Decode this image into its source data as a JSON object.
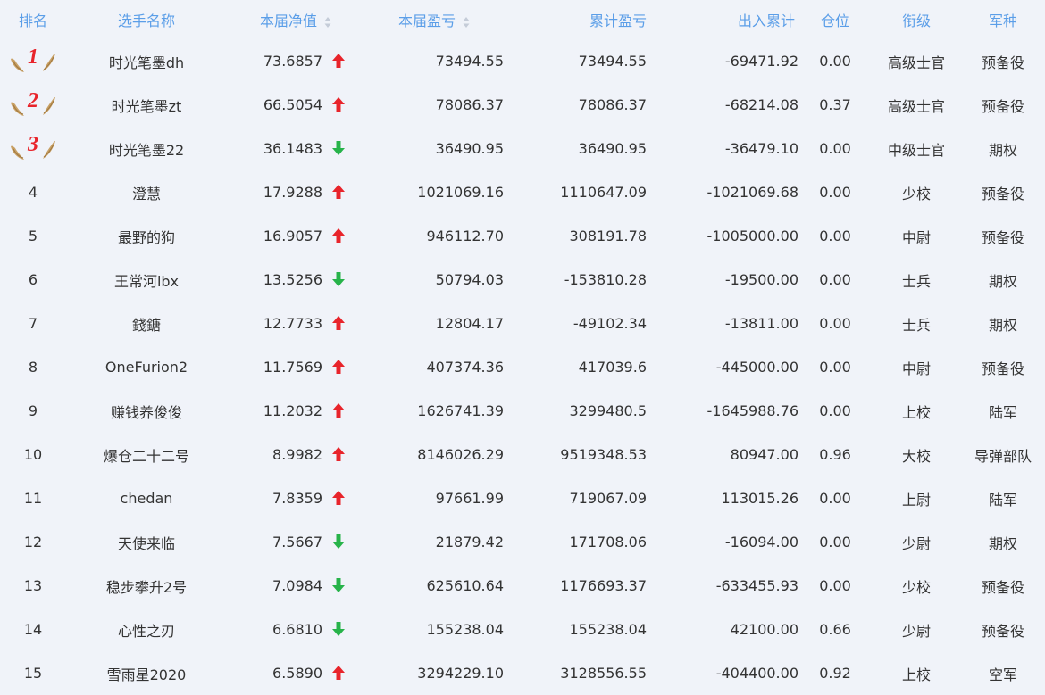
{
  "colors": {
    "header_text": "#5b9ee8",
    "up": "#e8242b",
    "down": "#27b34a",
    "wing": "#c8a064"
  },
  "columns": [
    "排名",
    "选手名称",
    "本届净值",
    "本届盈亏",
    "累计盈亏",
    "出入累计",
    "仓位",
    "衔级",
    "军种"
  ],
  "rows": [
    {
      "rank": "1",
      "name": "时光笔墨dh",
      "nav": "73.6857",
      "trend": "up",
      "pnl": "73494.55",
      "cum": "73494.55",
      "flow": "-69471.92",
      "pos": "0.00",
      "grade": "高级士官",
      "branch": "预备役"
    },
    {
      "rank": "2",
      "name": "时光笔墨zt",
      "nav": "66.5054",
      "trend": "up",
      "pnl": "78086.37",
      "cum": "78086.37",
      "flow": "-68214.08",
      "pos": "0.37",
      "grade": "高级士官",
      "branch": "预备役"
    },
    {
      "rank": "3",
      "name": "时光笔墨22",
      "nav": "36.1483",
      "trend": "down",
      "pnl": "36490.95",
      "cum": "36490.95",
      "flow": "-36479.10",
      "pos": "0.00",
      "grade": "中级士官",
      "branch": "期权"
    },
    {
      "rank": "4",
      "name": "澄慧",
      "nav": "17.9288",
      "trend": "up",
      "pnl": "1021069.16",
      "cum": "1110647.09",
      "flow": "-1021069.68",
      "pos": "0.00",
      "grade": "少校",
      "branch": "预备役"
    },
    {
      "rank": "5",
      "name": "最野的狗",
      "nav": "16.9057",
      "trend": "up",
      "pnl": "946112.70",
      "cum": "308191.78",
      "flow": "-1005000.00",
      "pos": "0.00",
      "grade": "中尉",
      "branch": "预备役"
    },
    {
      "rank": "6",
      "name": "王常河lbx",
      "nav": "13.5256",
      "trend": "down",
      "pnl": "50794.03",
      "cum": "-153810.28",
      "flow": "-19500.00",
      "pos": "0.00",
      "grade": "士兵",
      "branch": "期权"
    },
    {
      "rank": "7",
      "name": "錢鎕",
      "nav": "12.7733",
      "trend": "up",
      "pnl": "12804.17",
      "cum": "-49102.34",
      "flow": "-13811.00",
      "pos": "0.00",
      "grade": "士兵",
      "branch": "期权"
    },
    {
      "rank": "8",
      "name": "OneFurion2",
      "nav": "11.7569",
      "trend": "up",
      "pnl": "407374.36",
      "cum": "417039.6",
      "flow": "-445000.00",
      "pos": "0.00",
      "grade": "中尉",
      "branch": "预备役"
    },
    {
      "rank": "9",
      "name": "赚钱养俊俊",
      "nav": "11.2032",
      "trend": "up",
      "pnl": "1626741.39",
      "cum": "3299480.5",
      "flow": "-1645988.76",
      "pos": "0.00",
      "grade": "上校",
      "branch": "陆军"
    },
    {
      "rank": "10",
      "name": "爆仓二十二号",
      "nav": "8.9982",
      "trend": "up",
      "pnl": "8146026.29",
      "cum": "9519348.53",
      "flow": "80947.00",
      "pos": "0.96",
      "grade": "大校",
      "branch": "导弹部队"
    },
    {
      "rank": "11",
      "name": "chedan",
      "nav": "7.8359",
      "trend": "up",
      "pnl": "97661.99",
      "cum": "719067.09",
      "flow": "113015.26",
      "pos": "0.00",
      "grade": "上尉",
      "branch": "陆军"
    },
    {
      "rank": "12",
      "name": "天使来临",
      "nav": "7.5667",
      "trend": "down",
      "pnl": "21879.42",
      "cum": "171708.06",
      "flow": "-16094.00",
      "pos": "0.00",
      "grade": "少尉",
      "branch": "期权"
    },
    {
      "rank": "13",
      "name": "稳步攀升2号",
      "nav": "7.0984",
      "trend": "down",
      "pnl": "625610.64",
      "cum": "1176693.37",
      "flow": "-633455.93",
      "pos": "0.00",
      "grade": "少校",
      "branch": "预备役"
    },
    {
      "rank": "14",
      "name": "心性之刃",
      "nav": "6.6810",
      "trend": "down",
      "pnl": "155238.04",
      "cum": "155238.04",
      "flow": "42100.00",
      "pos": "0.66",
      "grade": "少尉",
      "branch": "预备役"
    },
    {
      "rank": "15",
      "name": "雪雨星2020",
      "nav": "6.5890",
      "trend": "up",
      "pnl": "3294229.10",
      "cum": "3128556.55",
      "flow": "-404400.00",
      "pos": "0.92",
      "grade": "上校",
      "branch": "空军"
    }
  ]
}
